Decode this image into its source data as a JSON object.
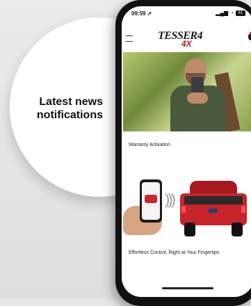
{
  "callout": {
    "text_line1": "Latest news",
    "text_line2": "notifications"
  },
  "status_bar": {
    "time": "09:59",
    "battery": "61",
    "icons": [
      "location-arrow-icon",
      "signal-icon",
      "wifi-icon",
      "battery-icon"
    ]
  },
  "header": {
    "logo_main": "TESSER4",
    "logo_sub": "4X",
    "icons": [
      "menu-icon",
      "bell-icon"
    ]
  },
  "news": [
    {
      "title": "Warranty Activation"
    },
    {
      "title": "Effortless Control, Right at Your Fingertips"
    }
  ],
  "colors": {
    "accent": "#c4161c",
    "truck": "#c7242b",
    "background": "#e4e6e7"
  }
}
